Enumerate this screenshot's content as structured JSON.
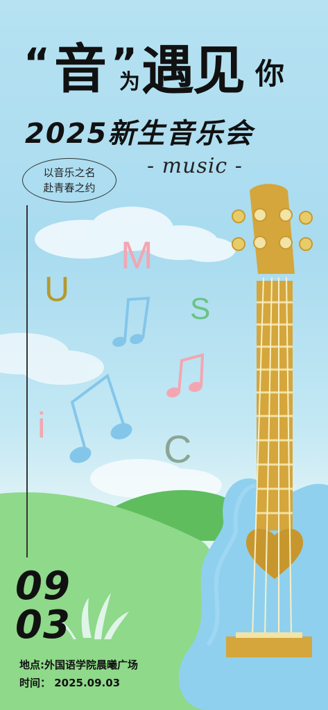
{
  "title": {
    "quote_open": "“",
    "char_yin": "音",
    "quote_close": "”",
    "char_wei": "为",
    "chars_yujian": "遇见",
    "char_ni": "你"
  },
  "subtitle": "2025新生音乐会",
  "music_tag": "- music -",
  "slogan": {
    "line1": "以音乐之名",
    "line2": "赴青春之约"
  },
  "letters": [
    "M",
    "U",
    "S",
    "i",
    "C"
  ],
  "date": {
    "month": "09",
    "day": "03"
  },
  "info": {
    "location": "地点:外国语学院晨曦广场",
    "time": "时间：  2025.09.03"
  },
  "colors": {
    "sky": "#b6e2f2",
    "hill_front": "#8fd98a",
    "hill_back": "#63c062",
    "guitar_body": "#8fd0ef",
    "guitar_neck": "#d4a63c",
    "pink": "#f3a6b1",
    "blue_note": "#7cc4ec"
  }
}
